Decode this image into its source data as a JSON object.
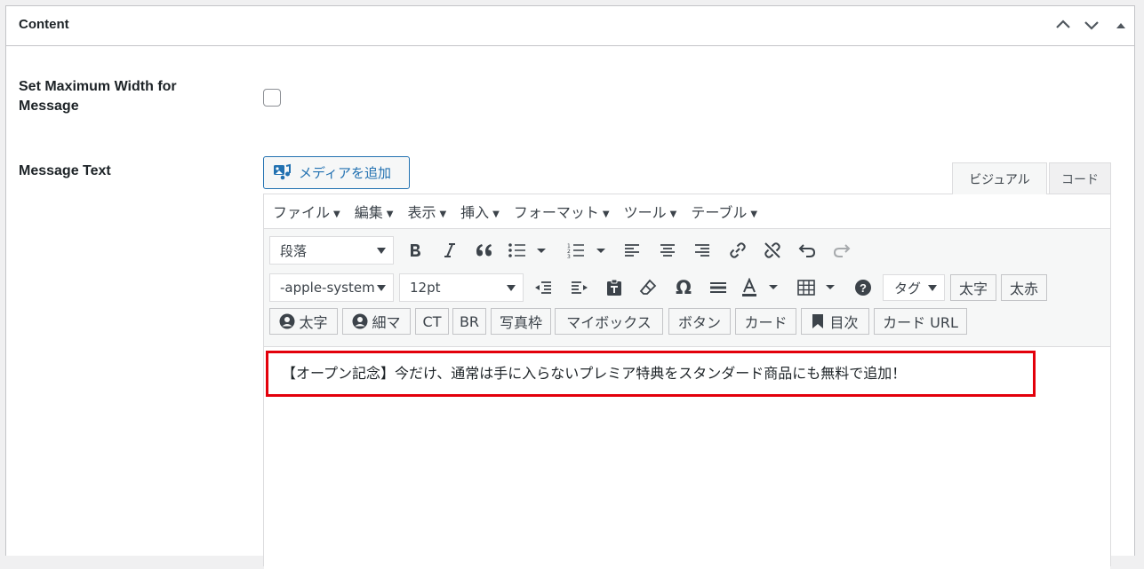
{
  "panel": {
    "title": "Content",
    "controls": [
      "chevron-up-icon",
      "chevron-down-icon",
      "triangle-up-icon"
    ]
  },
  "fields": {
    "max_width_label": "Set Maximum Width for Message",
    "max_width_checked": false,
    "message_text_label": "Message Text"
  },
  "editor": {
    "media_button_label": "メディアを追加",
    "tabs": {
      "visual": "ビジュアル",
      "code": "コード"
    },
    "menus": [
      "ファイル",
      "編集",
      "表示",
      "挿入",
      "フォーマット",
      "ツール",
      "テーブル"
    ],
    "format_select": "段落",
    "font_select": "-apple-system",
    "size_select": "12pt",
    "tag_select": "タグ",
    "buttons": {
      "bold_jp": "太字",
      "bold_red": "太赤",
      "avatar_bold": "太字",
      "avatar_thin": "細マ",
      "ct": "CT",
      "br": "BR",
      "photo_frame": "写真枠",
      "my_box": "マイボックス",
      "button": "ボタン",
      "card": "カード",
      "toc": "目次",
      "card_url": "カード URL"
    },
    "content": "【オープン記念】今だけ、通常は手に入らないプレミア特典をスタンダード商品にも無料で追加！"
  },
  "colors": {
    "accent": "#2271b1",
    "highlight": "#e3000b",
    "border": "#c3c4c7"
  }
}
